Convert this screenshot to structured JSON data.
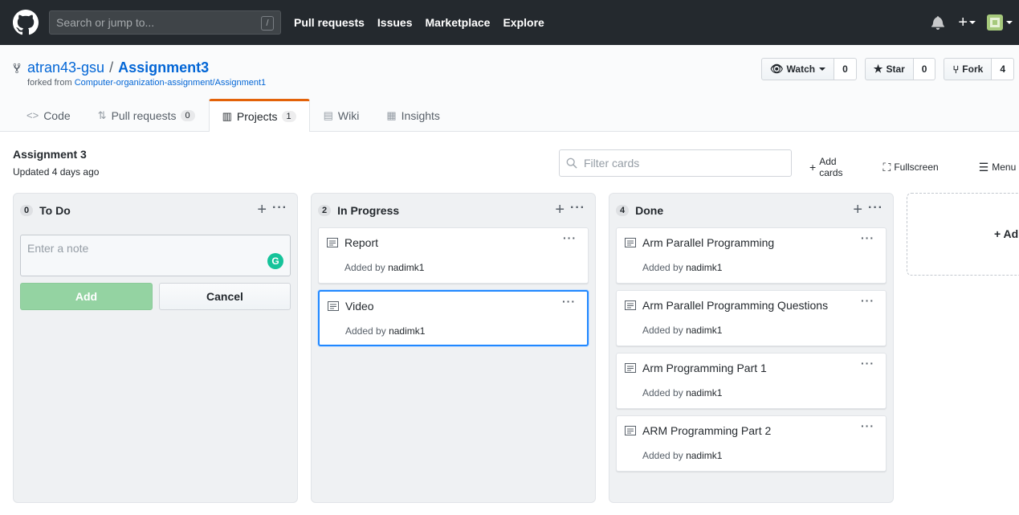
{
  "header": {
    "search_placeholder": "Search or jump to...",
    "search_key": "/",
    "nav": [
      "Pull requests",
      "Issues",
      "Marketplace",
      "Explore"
    ]
  },
  "repo": {
    "owner": "atran43-gsu",
    "separator": "/",
    "name": "Assignment3",
    "forked_prefix": "forked from",
    "forked_from": "Computer-organization-assignment/Assignment1",
    "watch_label": "Watch",
    "watch_count": "0",
    "star_label": "Star",
    "star_count": "0",
    "fork_label": "Fork",
    "fork_count": "4"
  },
  "tabs": [
    {
      "label": "Code",
      "badge": ""
    },
    {
      "label": "Pull requests",
      "badge": "0"
    },
    {
      "label": "Projects",
      "badge": "1"
    },
    {
      "label": "Wiki",
      "badge": ""
    },
    {
      "label": "Insights",
      "badge": ""
    }
  ],
  "project": {
    "title": "Assignment 3",
    "updated": "Updated 4 days ago",
    "filter_placeholder": "Filter cards",
    "add_cards": "Add cards",
    "fullscreen": "Fullscreen",
    "menu": "Menu",
    "add_column": "+ Ad"
  },
  "columns": [
    {
      "count": "0",
      "name": "To Do",
      "note_placeholder": "Enter a note",
      "add_label": "Add",
      "cancel_label": "Cancel",
      "cards": []
    },
    {
      "count": "2",
      "name": "In Progress",
      "cards": [
        {
          "title": "Report",
          "added_by": "Added by",
          "user": "nadimk1"
        },
        {
          "title": "Video",
          "added_by": "Added by",
          "user": "nadimk1"
        }
      ]
    },
    {
      "count": "4",
      "name": "Done",
      "cards": [
        {
          "title": "Arm Parallel Programming",
          "added_by": "Added by",
          "user": "nadimk1"
        },
        {
          "title": "Arm Parallel Programming Questions",
          "added_by": "Added by",
          "user": "nadimk1"
        },
        {
          "title": "Arm Programming Part 1",
          "added_by": "Added by",
          "user": "nadimk1"
        },
        {
          "title": "ARM Programming Part 2",
          "added_by": "Added by",
          "user": "nadimk1"
        }
      ]
    }
  ],
  "colors": {
    "header_bg": "#24292e",
    "link": "#0366d6",
    "tab_accent": "#e36209",
    "add_button": "#94d3a2"
  }
}
